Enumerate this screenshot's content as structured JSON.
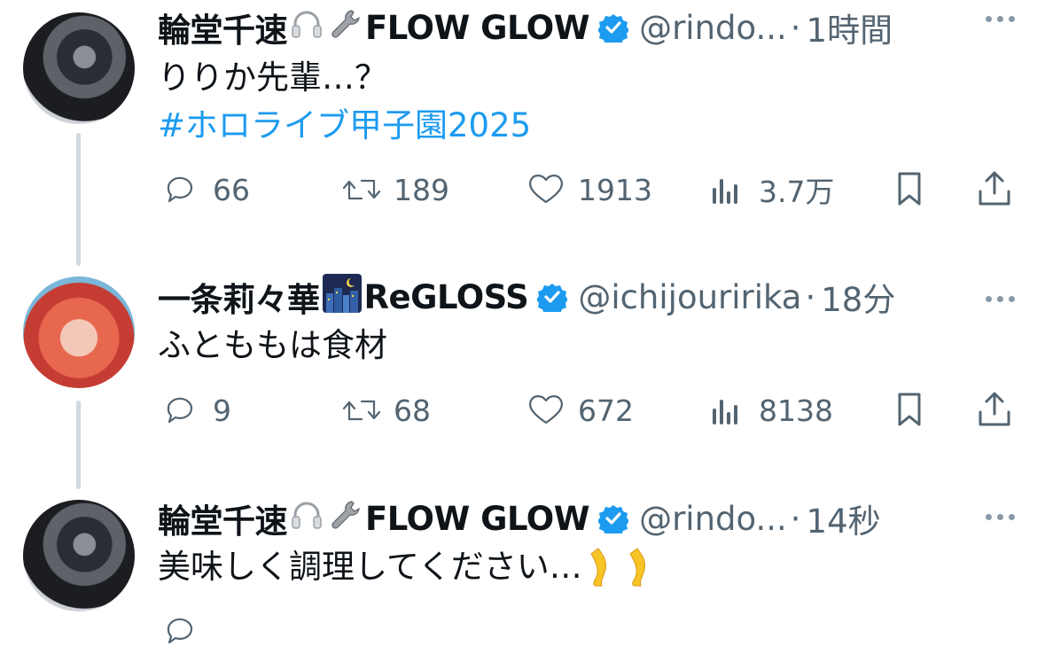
{
  "tweets": [
    {
      "name": "輪堂千速",
      "emojis": [
        "headphone-icon",
        "wrench-icon"
      ],
      "affiliation": "FLOW GLOW",
      "handle": "@rindo...",
      "time": "1時間",
      "text": "りりか先輩…？",
      "hashtag": "#ホロライブ甲子園2025",
      "replies": "66",
      "retweets": "189",
      "likes": "1913",
      "views": "3.7万"
    },
    {
      "name": "一条莉々華",
      "emojis": [
        "night-city-icon"
      ],
      "affiliation": "ReGLOSS",
      "handle": "@ichijouririka",
      "time": "18分",
      "text": "ふとももは食材",
      "replies": "9",
      "retweets": "68",
      "likes": "672",
      "views": "8138"
    },
    {
      "name": "輪堂千速",
      "emojis": [
        "headphone-icon",
        "wrench-icon"
      ],
      "affiliation": "FLOW GLOW",
      "handle": "@rindo...",
      "time": "14秒",
      "text": "美味しく調理してください…",
      "text_emojis": [
        "leg-icon",
        "leg-icon"
      ]
    }
  ],
  "colors": {
    "accent": "#1d9bf0",
    "secondary": "#536471",
    "thread_line": "#cfd9de"
  }
}
